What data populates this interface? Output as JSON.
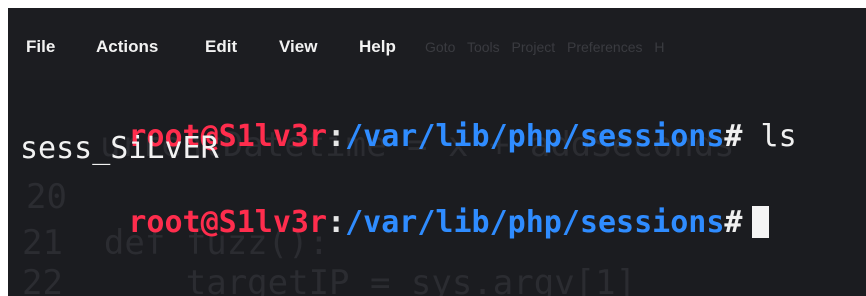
{
  "menu": {
    "items": [
      "File",
      "Actions",
      "Edit",
      "View",
      "Help"
    ],
    "ghost_items": "Goto Tools Project Preferences H"
  },
  "terminal": {
    "prompt_user": "root@S1lv3r",
    "prompt_colon": ":",
    "prompt_path": "/var/lib/php/sessions",
    "prompt_symbol": "#",
    "command": "ls",
    "output": "sess_SiLvER"
  },
  "background_code": {
    "line1": "urrentDatetime = x + addSeconds",
    "line2": "20",
    "line3": "21  def fuzz():",
    "line4": "22      targetIP = sys.argv[1]"
  },
  "colors": {
    "background": "#1b1c20",
    "user": "#ff2d4d",
    "path": "#2f8cff",
    "text": "#f0f0f0"
  }
}
